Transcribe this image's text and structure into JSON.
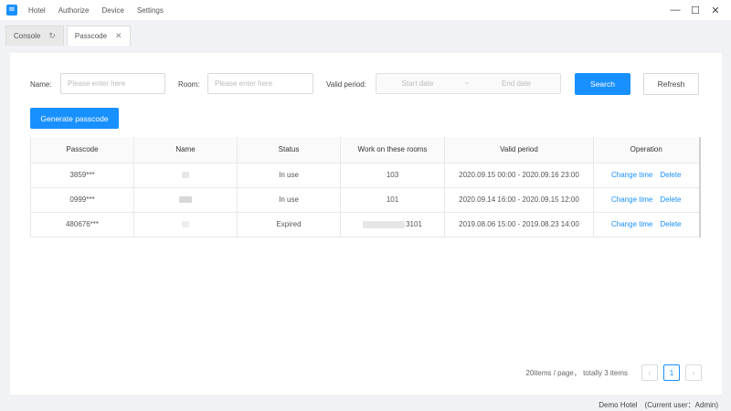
{
  "titlebar": {
    "logo_text": "ttl",
    "menu": [
      "Hotel",
      "Authorize",
      "Device",
      "Settings"
    ],
    "controls": {
      "minimize": "—",
      "maximize": "☐",
      "close": "✕"
    }
  },
  "tabs": [
    {
      "label": "Console",
      "icon": "↻",
      "icon_name": "refresh-icon"
    },
    {
      "label": "Passcode",
      "icon": "✕",
      "icon_name": "close-icon"
    }
  ],
  "filters": {
    "name_label": "Name:",
    "name_placeholder": "Please enter here",
    "room_label": "Room:",
    "room_placeholder": "Please enter here",
    "period_label": "Valid period:",
    "start_placeholder": "Start date",
    "range_separator": "~",
    "end_placeholder": "End date",
    "search_button": "Search",
    "refresh_button": "Refresh"
  },
  "generate_button": "Generate passcode",
  "table": {
    "headers": [
      "Passcode",
      "Name",
      "Status",
      "Work on these rooms",
      "Valid period",
      "Operation"
    ],
    "rows": [
      {
        "passcode": "3859***",
        "status": "In use",
        "rooms": "103",
        "period": "2020.09.15 00:00 - 2020.09.16 23:00",
        "op_change": "Change time",
        "op_delete": "Delete"
      },
      {
        "passcode": "0999***",
        "status": "In use",
        "rooms": "101",
        "period": "2020.09.14 16:00 - 2020.09.15 12:00",
        "op_change": "Change time",
        "op_delete": "Delete"
      },
      {
        "passcode": "480676***",
        "status": "Expired",
        "rooms": "3101",
        "period": "2019.08.06 15:00 - 2019.08.23 14:00",
        "op_change": "Change time",
        "op_delete": "Delete"
      }
    ]
  },
  "pagination": {
    "summary": "20items / page，  totally 3 items",
    "prev": "‹",
    "current": "1",
    "next": "›"
  },
  "statusbar": {
    "hotel": "Demo Hotel",
    "user": "(Current user：Admin)"
  },
  "colors": {
    "primary": "#1890ff",
    "danger": "#f5222d",
    "background": "#f0f2f5"
  }
}
